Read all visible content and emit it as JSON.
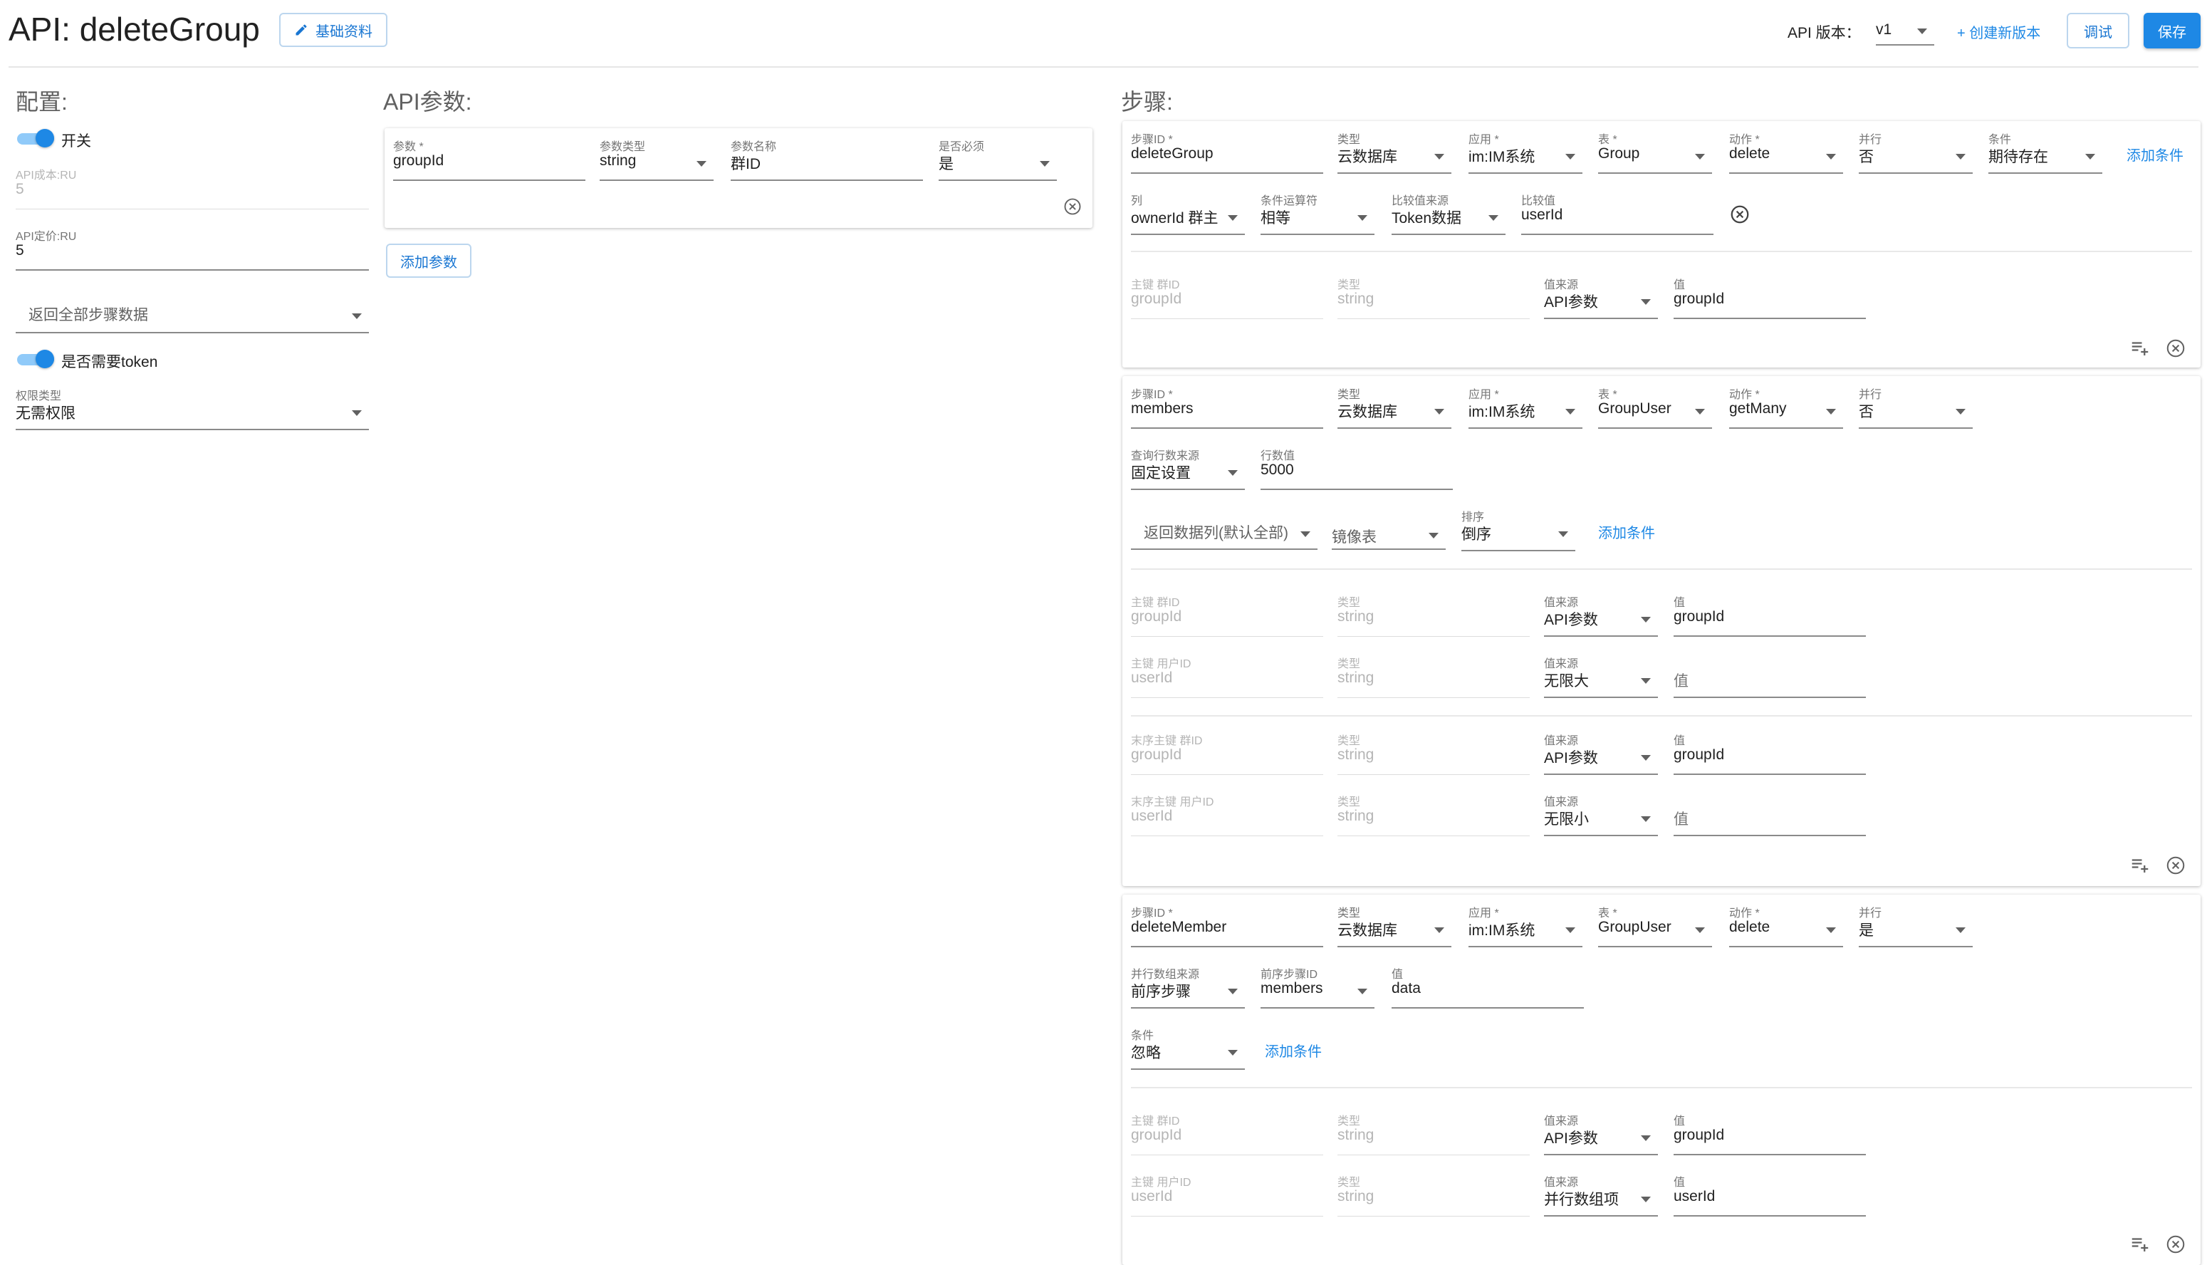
{
  "header": {
    "title": "API: deleteGroup",
    "basic_info_label": "基础资料",
    "version_label": "API 版本：",
    "version_value": "v1",
    "new_version_label": "+ 创建新版本",
    "debug_label": "调试",
    "save_label": "保存"
  },
  "config": {
    "title": "配置:",
    "switch_label": "开关",
    "cost_label": "API成本:RU",
    "cost_value": "5",
    "price_label": "API定价:RU",
    "price_value": "5",
    "return_select": "返回全部步骤数据",
    "token_label": "是否需要token",
    "perm_label": "权限类型",
    "perm_value": "无需权限"
  },
  "params": {
    "title": "API参数:",
    "param_label": "参数 *",
    "param_value": "groupId",
    "type_label": "参数类型",
    "type_value": "string",
    "name_label": "参数名称",
    "name_value": "群ID",
    "required_label": "是否必须",
    "required_value": "是",
    "add_label": "添加参数"
  },
  "steps": {
    "title": "步骤:",
    "add_condition": "添加条件",
    "step1": {
      "id_label": "步骤ID *",
      "id": "deleteGroup",
      "type_label": "类型",
      "type": "云数据库",
      "app_label": "应用 *",
      "app": "im:IM系统",
      "table_label": "表 *",
      "table": "Group",
      "action_label": "动作 *",
      "action": "delete",
      "parallel_label": "并行",
      "parallel": "否",
      "cond_label": "条件",
      "cond": "期待存在",
      "col_label": "列",
      "col": "ownerId 群主",
      "op_label": "条件运算符",
      "op": "相等",
      "src_label": "比较值来源",
      "src": "Token数据",
      "cmp_label": "比较值",
      "cmp": "userId",
      "keys": [
        {
          "key_label": "主键 群ID",
          "key": "groupId",
          "type_label": "类型",
          "type": "string",
          "src_label": "值来源",
          "src": "API参数",
          "val_label": "值",
          "val": "groupId"
        }
      ]
    },
    "step2": {
      "id_label": "步骤ID *",
      "id": "members",
      "type_label": "类型",
      "type": "云数据库",
      "app_label": "应用 *",
      "app": "im:IM系统",
      "table_label": "表 *",
      "table": "GroupUser",
      "action_label": "动作 *",
      "action": "getMany",
      "parallel_label": "并行",
      "parallel": "否",
      "rows_src_label": "查询行数来源",
      "rows_src": "固定设置",
      "rows_label": "行数值",
      "rows": "5000",
      "return_cols": "返回数据列(默认全部)",
      "mirror": "镜像表",
      "sort_label": "排序",
      "sort": "倒序",
      "keys": [
        {
          "key_label": "主键 群ID",
          "key": "groupId",
          "type_label": "类型",
          "type": "string",
          "src_label": "值来源",
          "src": "API参数",
          "val_label": "值",
          "val": "groupId"
        },
        {
          "key_label": "主键 用户ID",
          "key": "userId",
          "type_label": "类型",
          "type": "string",
          "src_label": "值来源",
          "src": "无限大",
          "val_label": "",
          "val": "值"
        },
        {
          "key_label": "末序主键 群ID",
          "key": "groupId",
          "type_label": "类型",
          "type": "string",
          "src_label": "值来源",
          "src": "API参数",
          "val_label": "值",
          "val": "groupId"
        },
        {
          "key_label": "末序主键 用户ID",
          "key": "userId",
          "type_label": "类型",
          "type": "string",
          "src_label": "值来源",
          "src": "无限小",
          "val_label": "",
          "val": "值"
        }
      ]
    },
    "step3": {
      "id_label": "步骤ID *",
      "id": "deleteMember",
      "type_label": "类型",
      "type": "云数据库",
      "app_label": "应用 *",
      "app": "im:IM系统",
      "table_label": "表 *",
      "table": "GroupUser",
      "action_label": "动作 *",
      "action": "delete",
      "parallel_label": "并行",
      "parallel": "是",
      "par_src_label": "并行数组来源",
      "par_src": "前序步骤",
      "prev_label": "前序步骤ID",
      "prev": "members",
      "val_label": "值",
      "val": "data",
      "cond_label": "条件",
      "cond": "忽略",
      "keys": [
        {
          "key_label": "主键 群ID",
          "key": "groupId",
          "type_label": "类型",
          "type": "string",
          "src_label": "值来源",
          "src": "API参数",
          "val_label": "值",
          "val": "groupId"
        },
        {
          "key_label": "主键 用户ID",
          "key": "userId",
          "type_label": "类型",
          "type": "string",
          "src_label": "值来源",
          "src": "并行数组项",
          "val_label": "值",
          "val": "userId"
        }
      ]
    }
  },
  "colors": {
    "accent": "#1e88e5",
    "switch_track": "#90caf9",
    "label": "#757575",
    "disabled": "#b5b5b5"
  }
}
